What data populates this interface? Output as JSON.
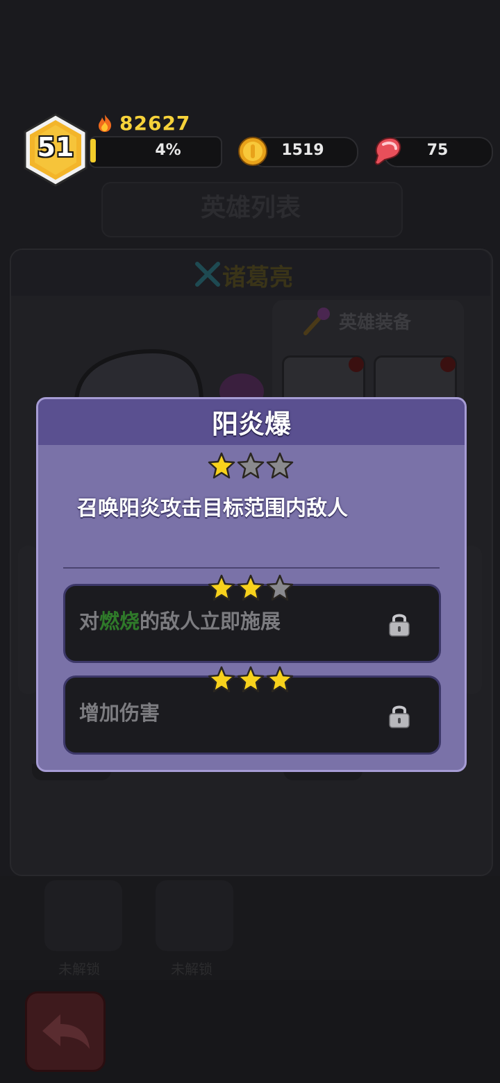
{
  "hud": {
    "level": "51",
    "power": "82627",
    "xp_percent_label": "4%",
    "xp_fraction": 0.04,
    "coins": "1519",
    "meat": "75"
  },
  "background_page": {
    "title": "英雄列表",
    "hero_name": "诸葛亮",
    "equipment_label": "英雄装备",
    "tabs": [
      {
        "label": "未解锁"
      },
      {
        "label": "未解锁"
      }
    ]
  },
  "skill_modal": {
    "title": "阳炎爆",
    "current_stars": 1,
    "max_stars": 3,
    "description": "召唤阳炎攻击目标范围内敌人",
    "upgrades": [
      {
        "required_stars": 2,
        "text_prefix": "对",
        "text_highlight": "燃烧",
        "text_suffix": "的敌人立即施展",
        "locked": true
      },
      {
        "required_stars": 3,
        "text_prefix": "增加伤害",
        "text_highlight": "",
        "text_suffix": "",
        "locked": true
      }
    ]
  },
  "colors": {
    "gold": "#f6d23a",
    "modal_bg": "#7a72a8",
    "modal_header": "#5a5090",
    "highlight_green": "#2f7a2a",
    "star_active": "#f8d21c",
    "star_inactive": "#8a8a8e"
  },
  "icons": [
    "hexagon-level-badge",
    "flame-icon",
    "gold-coin-icon",
    "meat-icon",
    "star-icon",
    "lock-icon",
    "back-arrow-icon"
  ]
}
